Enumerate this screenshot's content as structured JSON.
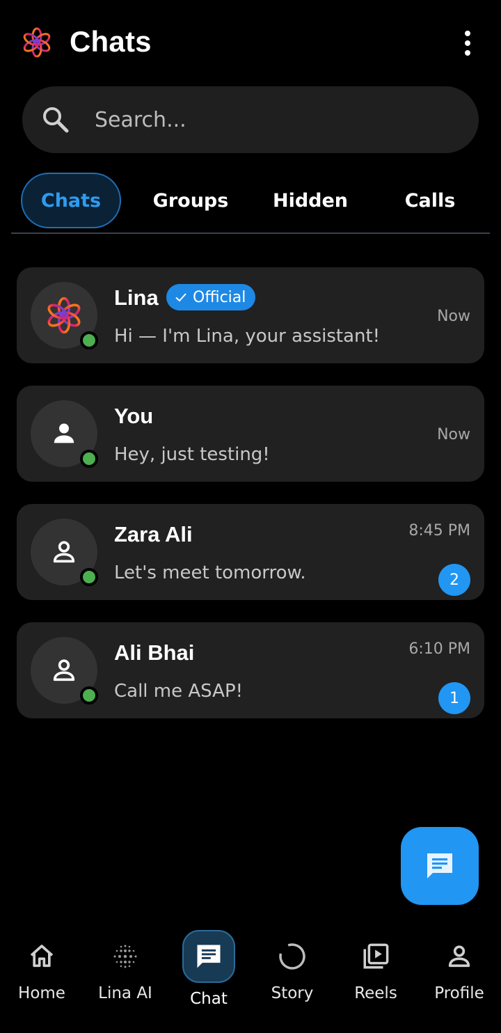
{
  "header": {
    "title": "Chats",
    "logo_icon": "lina-flower-logo-icon",
    "menu_icon": "more-vertical-icon"
  },
  "search": {
    "placeholder": "Search...",
    "value": ""
  },
  "tabs": [
    {
      "label": "Chats",
      "active": true
    },
    {
      "label": "Groups",
      "active": false
    },
    {
      "label": "Hidden",
      "active": false
    },
    {
      "label": "Calls",
      "active": false
    }
  ],
  "chats": [
    {
      "name": "Lina",
      "badge": "Official",
      "preview": "Hi — I'm Lina, your assistant!",
      "time": "Now",
      "unread": null,
      "online": true,
      "avatar": "lina-logo"
    },
    {
      "name": "You",
      "preview": "Hey, just testing!",
      "time": "Now",
      "unread": null,
      "online": true,
      "avatar": "person-filled"
    },
    {
      "name": "Zara Ali",
      "preview": "Let's meet tomorrow.",
      "time": "8:45 PM",
      "unread": "2",
      "online": true,
      "avatar": "person-outline"
    },
    {
      "name": "Ali Bhai",
      "preview": "Call me ASAP!",
      "time": "6:10 PM",
      "unread": "1",
      "online": true,
      "avatar": "person-outline"
    }
  ],
  "fab": {
    "icon": "new-chat-icon"
  },
  "bottom_nav": [
    {
      "label": "Home",
      "icon": "home-icon",
      "active": false
    },
    {
      "label": "Lina AI",
      "icon": "ai-dots-icon",
      "active": false
    },
    {
      "label": "Chat",
      "icon": "chat-icon",
      "active": true
    },
    {
      "label": "Story",
      "icon": "story-ring-icon",
      "active": false
    },
    {
      "label": "Reels",
      "icon": "reels-icon",
      "active": false
    },
    {
      "label": "Profile",
      "icon": "profile-icon",
      "active": false
    }
  ],
  "colors": {
    "accent": "#2196f3",
    "online": "#4caf50",
    "card": "#212121",
    "background": "#000000"
  }
}
